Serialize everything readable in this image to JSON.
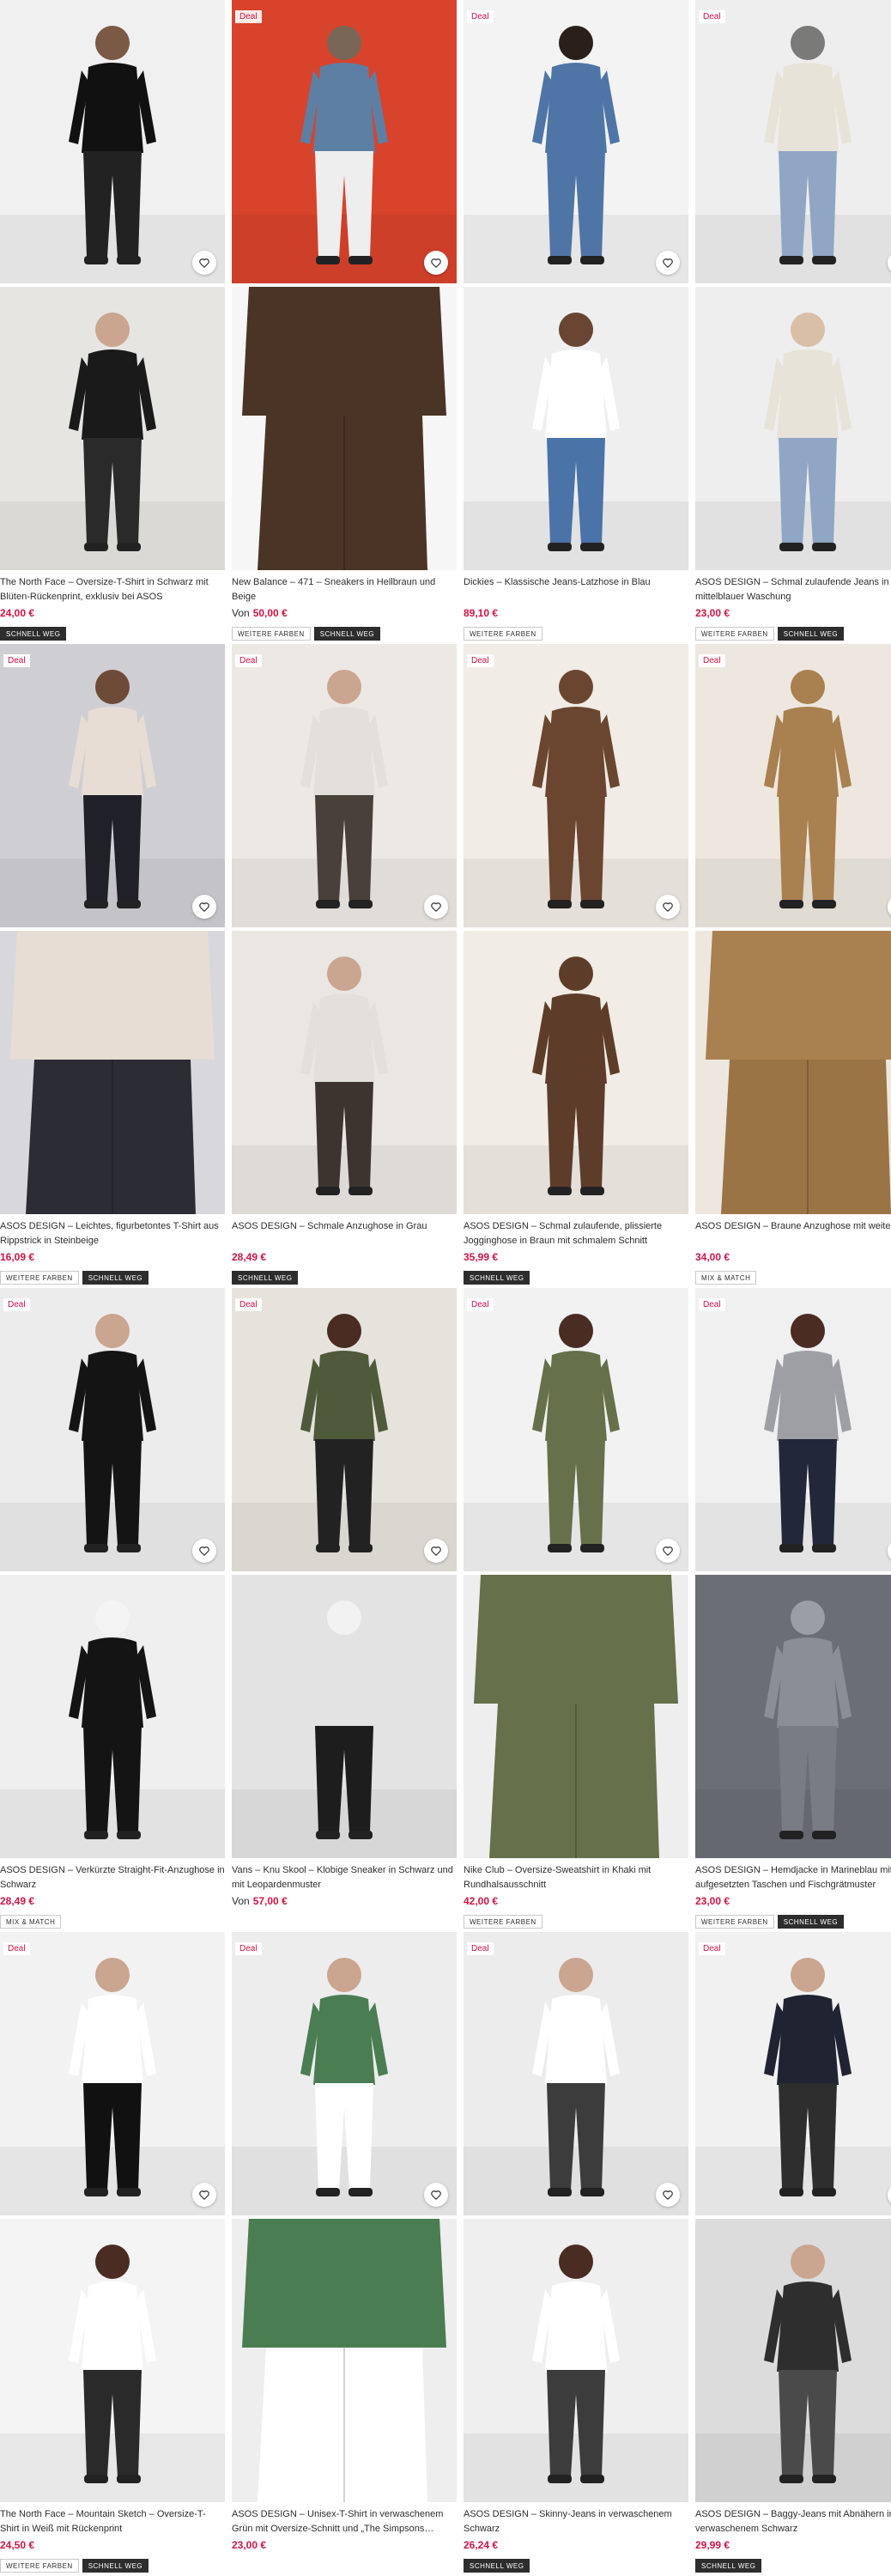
{
  "common": {
    "deal": "Deal"
  },
  "products": [
    {
      "title": "The North Face – Oversize-T-Shirt in Schwarz mit Blüten-Rückenprint, exklusiv bei ASOS",
      "from": "",
      "price": "24,00 €",
      "badges": [
        "SCHNELL WEG"
      ],
      "deal": false
    },
    {
      "title": "New Balance – 471 – Sneakers in Hellbraun und Beige",
      "from": "Von",
      "price": "50,00 €",
      "badges": [
        "WEITERE FARBEN",
        "SCHNELL WEG"
      ],
      "deal": true
    },
    {
      "title": "Dickies – Klassische Jeans-Latzhose in Blau",
      "from": "",
      "price": "89,10 €",
      "badges": [
        "WEITERE FARBEN"
      ],
      "deal": true
    },
    {
      "title": "ASOS DESIGN – Schmal zulaufende Jeans in mittelblauer Waschung",
      "from": "",
      "price": "23,00 €",
      "badges": [
        "WEITERE FARBEN",
        "SCHNELL WEG"
      ],
      "deal": true
    },
    {
      "title": "ASOS DESIGN – Leichtes, figurbetontes T-Shirt aus Rippstrick in Steinbeige",
      "from": "",
      "price": "16,09 €",
      "badges": [
        "WEITERE FARBEN",
        "SCHNELL WEG"
      ],
      "deal": true
    },
    {
      "title": "ASOS DESIGN – Schmale Anzughose in Grau",
      "from": "",
      "price": "28,49 €",
      "badges": [
        "SCHNELL WEG"
      ],
      "deal": true
    },
    {
      "title": "ASOS DESIGN – Schmal zulaufende, plissierte Jogginghose in Braun mit schmalem Schnitt",
      "from": "",
      "price": "35,99 €",
      "badges": [
        "SCHNELL WEG"
      ],
      "deal": true
    },
    {
      "title": "ASOS DESIGN – Braune Anzughose mit weitem Bein",
      "from": "",
      "price": "34,00 €",
      "badges": [
        "MIX & MATCH"
      ],
      "deal": true
    },
    {
      "title": "ASOS DESIGN – Verkürzte Straight-Fit-Anzughose in Schwarz",
      "from": "",
      "price": "28,49 €",
      "badges": [
        "MIX & MATCH"
      ],
      "deal": true
    },
    {
      "title": "Vans – Knu Skool – Klobige Sneaker in Schwarz und mit Leopardenmuster",
      "from": "Von",
      "price": "57,00 €",
      "badges": [],
      "deal": true
    },
    {
      "title": "Nike Club – Oversize-Sweatshirt in Khaki mit Rundhalsausschnitt",
      "from": "",
      "price": "42,00 €",
      "badges": [
        "WEITERE FARBEN"
      ],
      "deal": true
    },
    {
      "title": "ASOS DESIGN – Hemdjacke in Marineblau mit aufgesetzten Taschen und Fischgrätmuster",
      "from": "",
      "price": "23,00 €",
      "badges": [
        "WEITERE FARBEN",
        "SCHNELL WEG"
      ],
      "deal": true
    },
    {
      "title": "The North Face – Mountain Sketch – Oversize-T-Shirt in Weiß mit Rückenprint",
      "from": "",
      "price": "24,50 €",
      "badges": [
        "WEITERE FARBEN",
        "SCHNELL WEG"
      ],
      "deal": true
    },
    {
      "title": "ASOS DESIGN – Unisex-T-Shirt in verwaschenem Grün mit Oversize-Schnitt und „The Simpsons…",
      "from": "",
      "price": "23,00 €",
      "badges": [],
      "deal": true
    },
    {
      "title": "ASOS DESIGN – Skinny-Jeans in verwaschenem Schwarz",
      "from": "",
      "price": "26,24 €",
      "badges": [
        "SCHNELL WEG"
      ],
      "deal": true
    },
    {
      "title": "ASOS DESIGN – Baggy-Jeans mit Abnähern in verwaschenem Schwarz",
      "from": "",
      "price": "29,99 €",
      "badges": [
        "SCHNELL WEG"
      ],
      "deal": true
    }
  ]
}
